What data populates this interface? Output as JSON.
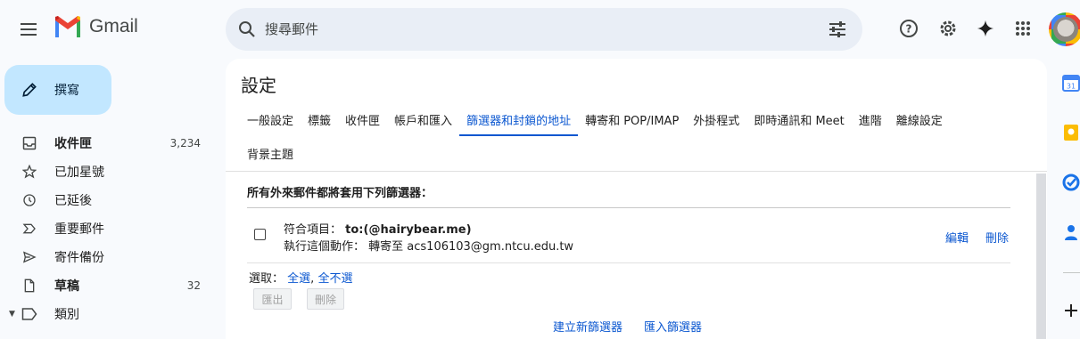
{
  "app": {
    "logo_text": "Gmail"
  },
  "search": {
    "placeholder": "搜尋郵件"
  },
  "compose": {
    "label": "撰寫"
  },
  "nav": [
    {
      "label": "收件匣",
      "count": "3,234",
      "icon": "inbox-icon",
      "bold": true
    },
    {
      "label": "已加星號",
      "count": "",
      "icon": "star-icon",
      "bold": false
    },
    {
      "label": "已延後",
      "count": "",
      "icon": "clock-icon",
      "bold": false
    },
    {
      "label": "重要郵件",
      "count": "",
      "icon": "important-icon",
      "bold": false
    },
    {
      "label": "寄件備份",
      "count": "",
      "icon": "send-icon",
      "bold": false
    },
    {
      "label": "草稿",
      "count": "32",
      "icon": "draft-icon",
      "bold": true
    },
    {
      "label": "類別",
      "count": "",
      "icon": "label-icon",
      "bold": false
    }
  ],
  "settings": {
    "title": "設定",
    "tabs": [
      "一般設定",
      "標籤",
      "收件匣",
      "帳戶和匯入",
      "篩選器和封鎖的地址",
      "轉寄和 POP/IMAP",
      "外掛程式",
      "即時通訊和 Meet",
      "進階",
      "離線設定"
    ],
    "tabs_row2": [
      "背景主題"
    ],
    "active_tab": "篩選器和封鎖的地址",
    "section_heading": "所有外來郵件都將套用下列篩選器：",
    "filter": {
      "match_label": "符合項目：",
      "match_value": "to:(@hairybear.me)",
      "action_label": "執行這個動作：",
      "action_value": "轉寄至 acs106103@gm.ntcu.edu.tw",
      "edit": "編輯",
      "delete": "刪除"
    },
    "select_label": "選取：",
    "select_all": "全選",
    "select_sep": ",",
    "select_none": "全不選",
    "export_btn": "匯出",
    "delete_btn": "刪除",
    "create_filter": "建立新篩選器",
    "import_filter": "匯入篩選器"
  },
  "colors": {
    "accent": "#0b57d0",
    "compose_bg": "#c2e7ff",
    "search_bg": "#e9eef6"
  }
}
